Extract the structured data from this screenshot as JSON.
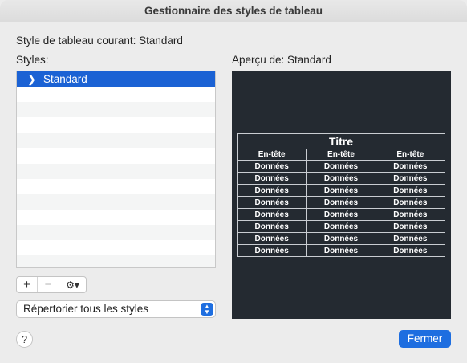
{
  "window": {
    "title": "Gestionnaire des styles de tableau"
  },
  "current_style": "Style de tableau courant: Standard",
  "styles_label": "Styles:",
  "styles_list": [
    {
      "label": "Standard",
      "selected": true
    }
  ],
  "toolbar": {
    "add": "+",
    "remove": "−",
    "gear": "⚙▾"
  },
  "filter_select": {
    "value": "Répertorier tous les styles"
  },
  "preview": {
    "label": "Aperçu de: Standard",
    "table": {
      "title": "Titre",
      "headers": [
        "En-tête",
        "En-tête",
        "En-tête"
      ],
      "rows": [
        [
          "Données",
          "Données",
          "Données"
        ],
        [
          "Données",
          "Données",
          "Données"
        ],
        [
          "Données",
          "Données",
          "Données"
        ],
        [
          "Données",
          "Données",
          "Données"
        ],
        [
          "Données",
          "Données",
          "Données"
        ],
        [
          "Données",
          "Données",
          "Données"
        ],
        [
          "Données",
          "Données",
          "Données"
        ],
        [
          "Données",
          "Données",
          "Données"
        ]
      ]
    }
  },
  "help_label": "?",
  "close_label": "Fermer",
  "colors": {
    "accent": "#1e6ee0",
    "selection": "#1b62d4",
    "preview_bg": "#242a31"
  }
}
